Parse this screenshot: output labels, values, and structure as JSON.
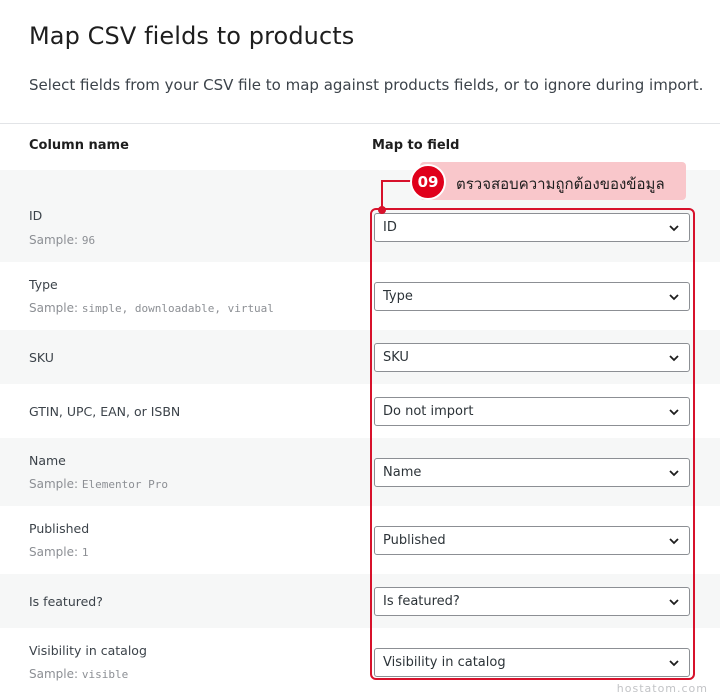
{
  "header": {
    "title": "Map CSV fields to products",
    "description": "Select fields from your CSV file to map against products fields, or to ignore during import."
  },
  "table": {
    "col_column_name": "Column name",
    "col_map_to_field": "Map to field",
    "rows": [
      {
        "label": "ID",
        "sample_prefix": "Sample:",
        "sample": "96",
        "mapped": "ID"
      },
      {
        "label": "Type",
        "sample_prefix": "Sample:",
        "sample": "simple, downloadable, virtual",
        "mapped": "Type"
      },
      {
        "label": "SKU",
        "sample_prefix": "",
        "sample": "",
        "mapped": "SKU"
      },
      {
        "label": "GTIN, UPC, EAN, or ISBN",
        "sample_prefix": "",
        "sample": "",
        "mapped": "Do not import"
      },
      {
        "label": "Name",
        "sample_prefix": "Sample:",
        "sample": "Elementor Pro",
        "mapped": "Name"
      },
      {
        "label": "Published",
        "sample_prefix": "Sample:",
        "sample": "1",
        "mapped": "Published"
      },
      {
        "label": "Is featured?",
        "sample_prefix": "",
        "sample": "",
        "mapped": "Is featured?"
      },
      {
        "label": "Visibility in catalog",
        "sample_prefix": "Sample:",
        "sample": "visible",
        "mapped": "Visibility in catalog"
      }
    ]
  },
  "callout": {
    "number": "09",
    "text": "ตรวจสอบความถูกต้องของข้อมูล",
    "color": "#d7112b",
    "banner_color": "#f9c7cb"
  },
  "watermark": "hostatom.com",
  "icons": {
    "select_arrow": "chevron-down-icon"
  }
}
